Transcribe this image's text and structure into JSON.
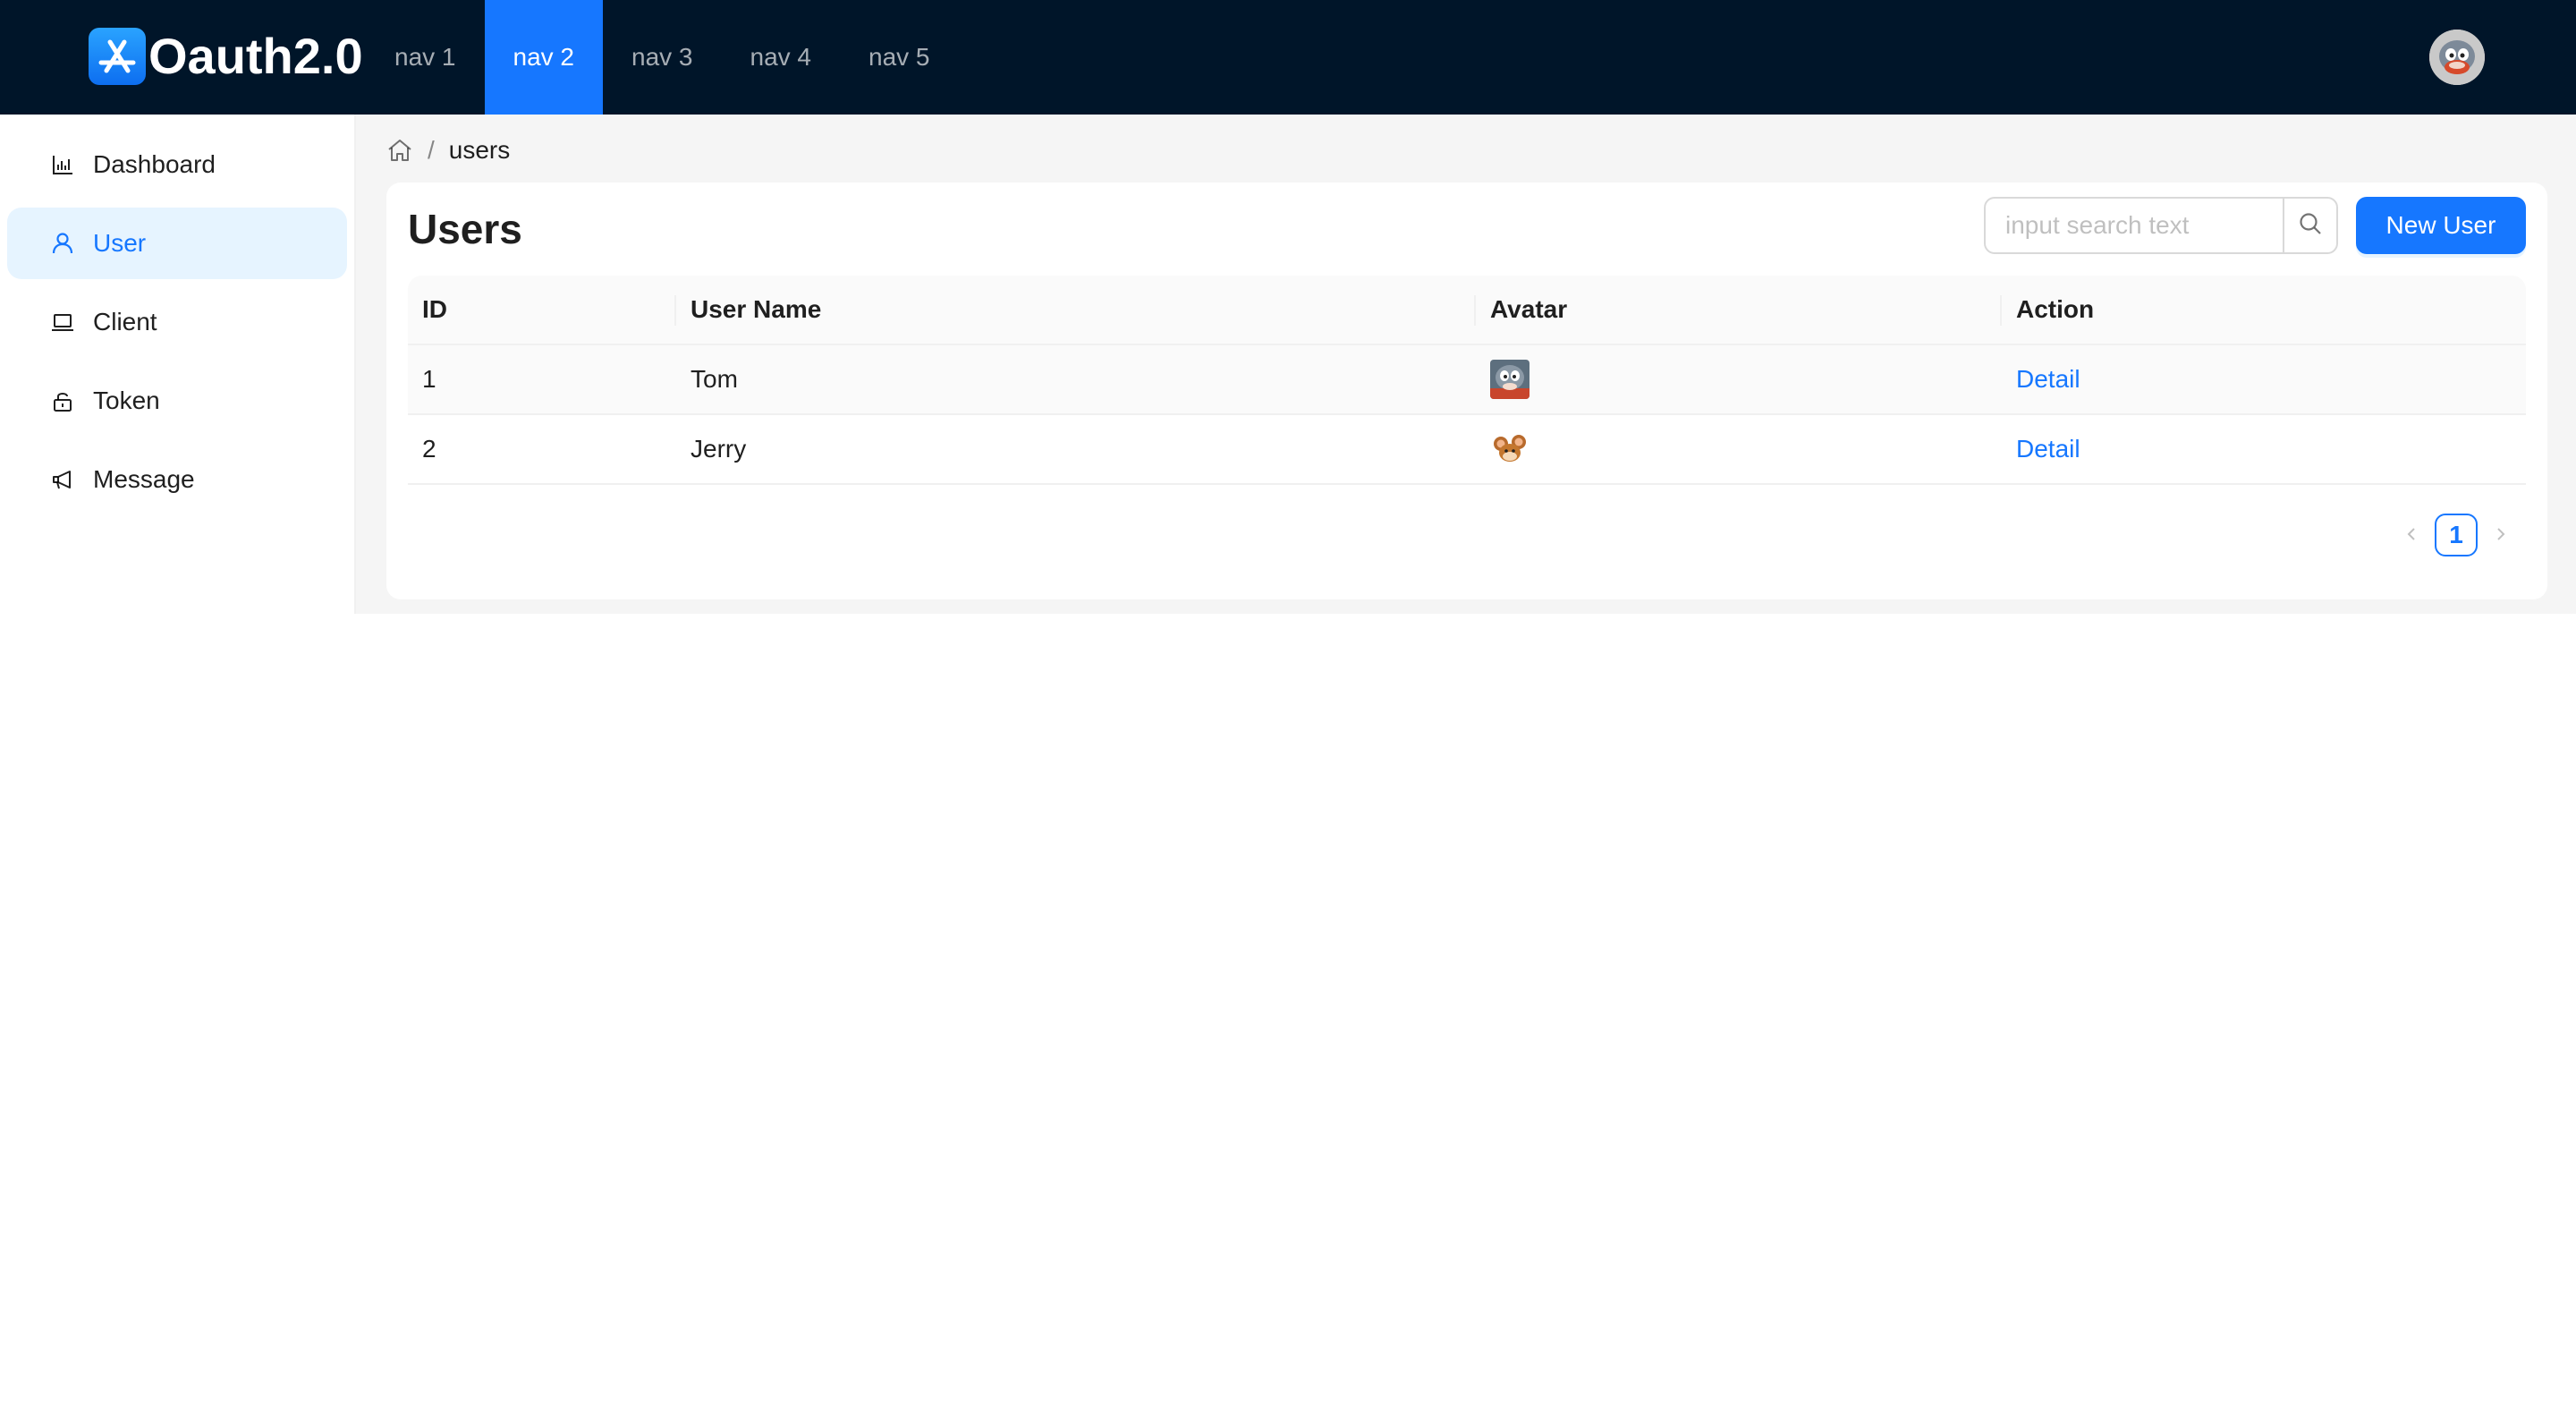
{
  "header": {
    "logo_text": "Oauth2.0",
    "nav": [
      {
        "label": "nav 1",
        "active": false
      },
      {
        "label": "nav 2",
        "active": true
      },
      {
        "label": "nav 3",
        "active": false
      },
      {
        "label": "nav 4",
        "active": false
      },
      {
        "label": "nav 5",
        "active": false
      }
    ],
    "background_color": "#001529",
    "accent_color": "#1677ff"
  },
  "sidebar": {
    "items": [
      {
        "label": "Dashboard",
        "icon": "bar-chart-icon",
        "selected": false
      },
      {
        "label": "User",
        "icon": "user-icon",
        "selected": true
      },
      {
        "label": "Client",
        "icon": "laptop-icon",
        "selected": false
      },
      {
        "label": "Token",
        "icon": "unlock-icon",
        "selected": false
      },
      {
        "label": "Message",
        "icon": "megaphone-icon",
        "selected": false
      }
    ]
  },
  "breadcrumb": {
    "home_icon": "home-icon",
    "separator": "/",
    "current": "users"
  },
  "main": {
    "title": "Users",
    "search": {
      "placeholder": "input search text",
      "value": ""
    },
    "new_user_label": "New User",
    "table": {
      "columns": [
        "ID",
        "User Name",
        "Avatar",
        "Action"
      ],
      "rows": [
        {
          "id": "1",
          "name": "Tom",
          "avatar": "tom-avatar",
          "action": "Detail"
        },
        {
          "id": "2",
          "name": "Jerry",
          "avatar": "jerry-avatar",
          "action": "Detail"
        }
      ]
    },
    "pagination": {
      "prev": "<",
      "current_page": "1",
      "next": ">"
    }
  }
}
